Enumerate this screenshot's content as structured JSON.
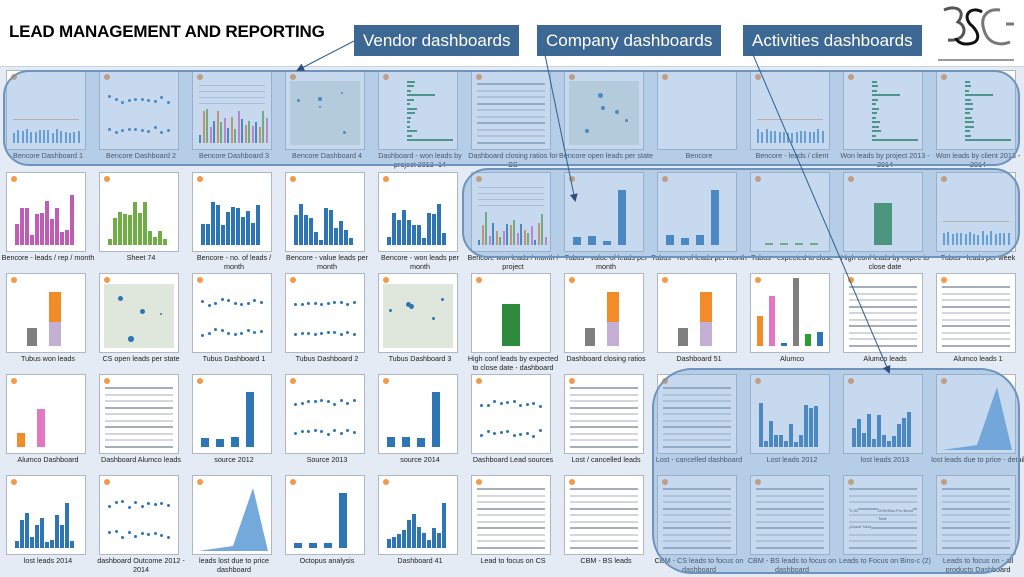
{
  "header": {
    "title": "LEAD MANAGEMENT AND REPORTING",
    "logo_text": "3SC",
    "callouts": [
      {
        "label": "Vendor dashboards",
        "color": "#3d6894"
      },
      {
        "label": "Company dashboards",
        "color": "#3d6894"
      },
      {
        "label": "Activities dashboards",
        "color": "#3d6894"
      }
    ]
  },
  "colors": {
    "accent_blue": "#2e75b6",
    "overlay": "#78a5d7",
    "panel_bg": "#e4ebf4"
  },
  "dashboards": [
    {
      "label": "Bencore Dashboard 1",
      "kind": "line"
    },
    {
      "label": "Bencore Dashboard 2",
      "kind": "dots"
    },
    {
      "label": "Bencore Dashboard 3",
      "kind": "dense"
    },
    {
      "label": "Bencore Dashboard 4",
      "kind": "map"
    },
    {
      "label": "Dashboard - won leads by project 2013 -14",
      "kind": "hbar"
    },
    {
      "label": "Dashboard closing ratios for BS",
      "kind": "table"
    },
    {
      "label": "Bencore open leads per state",
      "kind": "map"
    },
    {
      "label": "Bencore",
      "kind": "empty"
    },
    {
      "label": "Bencore - leads / client",
      "kind": "line"
    },
    {
      "label": "Won leads by project 2013 - 2014",
      "kind": "hbar"
    },
    {
      "label": "Won leads by client 2013 - 2014",
      "kind": "hbar"
    },
    {
      "label": "Bencore - leads / rep / month",
      "kind": "pinkbars"
    },
    {
      "label": "Sheet 74",
      "kind": "greenbars"
    },
    {
      "label": "Bencore - no. of leads / month",
      "kind": "bars"
    },
    {
      "label": "Bencore - value leads per month",
      "kind": "bars"
    },
    {
      "label": "Bencore - won leads per month",
      "kind": "bars"
    },
    {
      "label": "Bencore won leads / month / project",
      "kind": "dense"
    },
    {
      "label": "Tubus - value of leads per month",
      "kind": "fewbars"
    },
    {
      "label": "Tubus - no of leads per month",
      "kind": "fewbars"
    },
    {
      "label": "Tubus - expected to close",
      "kind": "flat"
    },
    {
      "label": "High conf leads by expec to close date",
      "kind": "greenbig"
    },
    {
      "label": "Tubus - leads per week",
      "kind": "line"
    },
    {
      "label": "Tubus won leads",
      "kind": "stack"
    },
    {
      "label": "CS open leads per state",
      "kind": "map"
    },
    {
      "label": "Tubus Dashboard 1",
      "kind": "dots"
    },
    {
      "label": "Tubus Dashboard 2",
      "kind": "dots"
    },
    {
      "label": "Tubus Dashboard 3",
      "kind": "map"
    },
    {
      "label": "High conf leads by expected to close date - dashboard",
      "kind": "greenbig"
    },
    {
      "label": "Dashboard closing ratios",
      "kind": "stack"
    },
    {
      "label": "Dashboard 51",
      "kind": "stack"
    },
    {
      "label": "Alumco",
      "kind": "multibar"
    },
    {
      "label": "Alumco leads",
      "kind": "table"
    },
    {
      "label": "Alumco leads 1",
      "kind": "table"
    },
    {
      "label": "Alumco Dashboard",
      "kind": "orangepink"
    },
    {
      "label": "Dashboard Alumco leads",
      "kind": "table"
    },
    {
      "label": "source 2012",
      "kind": "fewbars"
    },
    {
      "label": "Source 2013",
      "kind": "dots"
    },
    {
      "label": "source 2014",
      "kind": "fewbars"
    },
    {
      "label": "Dashboard Lead sources",
      "kind": "dots"
    },
    {
      "label": "Lost / cancelled leads",
      "kind": "table"
    },
    {
      "label": "Lost - cancelled dashboard",
      "kind": "table"
    },
    {
      "label": "Lost leads 2012",
      "kind": "bars"
    },
    {
      "label": "lost leads 2013",
      "kind": "bars"
    },
    {
      "label": "lost leads due to price - detail",
      "kind": "area"
    },
    {
      "label": "lost leads 2014",
      "kind": "bars"
    },
    {
      "label": "dashboard Outcome 2012 - 2014",
      "kind": "dots"
    },
    {
      "label": "leads lost due to price dashboard",
      "kind": "area"
    },
    {
      "label": "Octopus analysis",
      "kind": "fewbars"
    },
    {
      "label": "Dashboard 41",
      "kind": "bars"
    },
    {
      "label": "Lead to focus on CS",
      "kind": "table"
    },
    {
      "label": "CBM - BS leads",
      "kind": "table"
    },
    {
      "label": "CBM - CS leads to focus on dashboard",
      "kind": "table"
    },
    {
      "label": "CBM - BS leads to focus on dashboard",
      "kind": "table"
    },
    {
      "label": "Leads to Focus on Bins-c (2)",
      "kind": "totals"
    },
    {
      "label": "Leads to focus on - all products Dashboard",
      "kind": "table"
    }
  ],
  "totals_thumb": {
    "value": "0.39",
    "row_label": "DHS/Star-Pro Bond",
    "total": "Total",
    "grand_total": "Grand Total"
  }
}
